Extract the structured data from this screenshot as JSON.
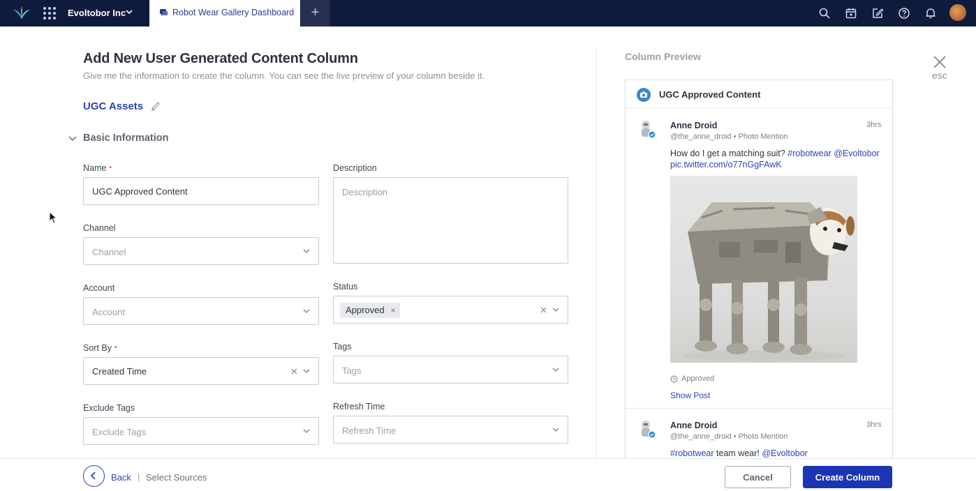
{
  "topbar": {
    "org_name": "Evoltobor Inc",
    "active_tab": "Robot Wear Gallery Dashboard",
    "add_tab": "+",
    "icons": [
      "search-icon",
      "calendar-icon",
      "compose-icon",
      "help-icon",
      "bell-icon"
    ]
  },
  "form": {
    "title": "Add New User Generated Content Column",
    "subtitle": "Give me the information to create the column. You can see the live preview of your column beside it.",
    "asset_group": "UGC Assets",
    "section_title": "Basic Information",
    "name": {
      "label": "Name",
      "required_mark": "•",
      "value": "UGC Approved Content"
    },
    "description": {
      "label": "Description",
      "placeholder": "Description"
    },
    "channel": {
      "label": "Channel",
      "placeholder": "Channel"
    },
    "account": {
      "label": "Account",
      "placeholder": "Account"
    },
    "status": {
      "label": "Status",
      "chip": "Approved",
      "chip_remove": "×"
    },
    "sort_by": {
      "label": "Sort By",
      "required_mark": "•",
      "value": "Created Time"
    },
    "tags": {
      "label": "Tags",
      "placeholder": "Tags"
    },
    "exclude_tags": {
      "label": "Exclude Tags",
      "placeholder": "Exclude Tags"
    },
    "refresh_time": {
      "label": "Refresh Time",
      "placeholder": "Refresh Time"
    }
  },
  "preview": {
    "label": "Column Preview",
    "esc": "esc",
    "column_title": "UGC Approved Content",
    "posts": [
      {
        "author": "Anne Droid",
        "handle": "@the_anne_droid • Photo Mention",
        "time": "3hrs",
        "text_plain": "How do I get a matching suit?",
        "text_link1": "#robotwear",
        "text_link2": "@Evoltobor pic.twitter.com/o77nGgFAwK",
        "status": "Approved",
        "show_post": "Show Post"
      },
      {
        "author": "Anne Droid",
        "handle": "@the_anne_droid • Photo Mention",
        "time": "3hrs",
        "text_link1": "#robotwear",
        "text_plain": "team wear!",
        "text_link2": "@Evoltobor"
      }
    ]
  },
  "footer": {
    "back": "Back",
    "separator": "|",
    "step": "Select Sources",
    "cancel": "Cancel",
    "create": "Create Column"
  },
  "colors": {
    "topbar": "#0f1b3d",
    "primary": "#1b35b5",
    "link": "#2a43b8",
    "required": "#e0483c"
  }
}
